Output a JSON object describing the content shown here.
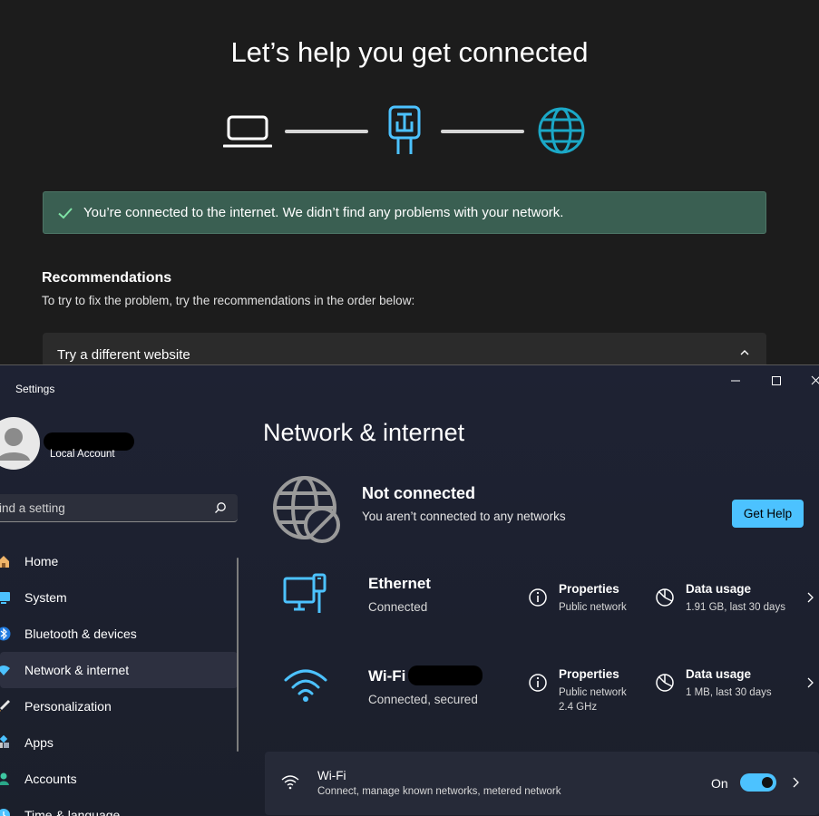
{
  "troubleshooter": {
    "title": "Let’s help you get connected",
    "banner": "You’re connected to the internet. We didn’t find any problems with your network.",
    "recommendations_title": "Recommendations",
    "recommendations_sub": "To try to fix the problem, try the recommendations in the order below:",
    "try_item": "Try a different website",
    "colors": {
      "banner": "#3a5f52",
      "accent": "#4cc2ff",
      "globe": "#1ba8c7"
    }
  },
  "settings": {
    "app_title": "Settings",
    "account_type": "Local Account",
    "search_placeholder": "ind a setting",
    "nav": [
      {
        "label": "Home",
        "icon": "home-icon"
      },
      {
        "label": "System",
        "icon": "monitor-icon"
      },
      {
        "label": "Bluetooth & devices",
        "icon": "bluetooth-icon"
      },
      {
        "label": "Network & internet",
        "icon": "wifi-icon",
        "active": true
      },
      {
        "label": "Personalization",
        "icon": "brush-icon"
      },
      {
        "label": "Apps",
        "icon": "apps-icon"
      },
      {
        "label": "Accounts",
        "icon": "person-icon"
      },
      {
        "label": "Time & language",
        "icon": "clock-icon"
      }
    ],
    "page_title": "Network & internet",
    "status": {
      "title": "Not connected",
      "subtitle": "You aren’t connected to any networks",
      "help_button": "Get Help"
    },
    "ethernet": {
      "name": "Ethernet",
      "status": "Connected",
      "properties_title": "Properties",
      "properties_sub": "Public network",
      "data_title": "Data usage",
      "data_sub": "1.91 GB, last 30 days"
    },
    "wifi_conn": {
      "name": "Wi-Fi (",
      "status": "Connected, secured",
      "properties_title": "Properties",
      "properties_sub1": "Public network",
      "properties_sub2": "2.4 GHz",
      "data_title": "Data usage",
      "data_sub": "1 MB, last 30 days"
    },
    "wifi_card": {
      "title": "Wi-Fi",
      "subtitle": "Connect, manage known networks, metered network",
      "toggle_label": "On",
      "toggle_on": true
    }
  }
}
